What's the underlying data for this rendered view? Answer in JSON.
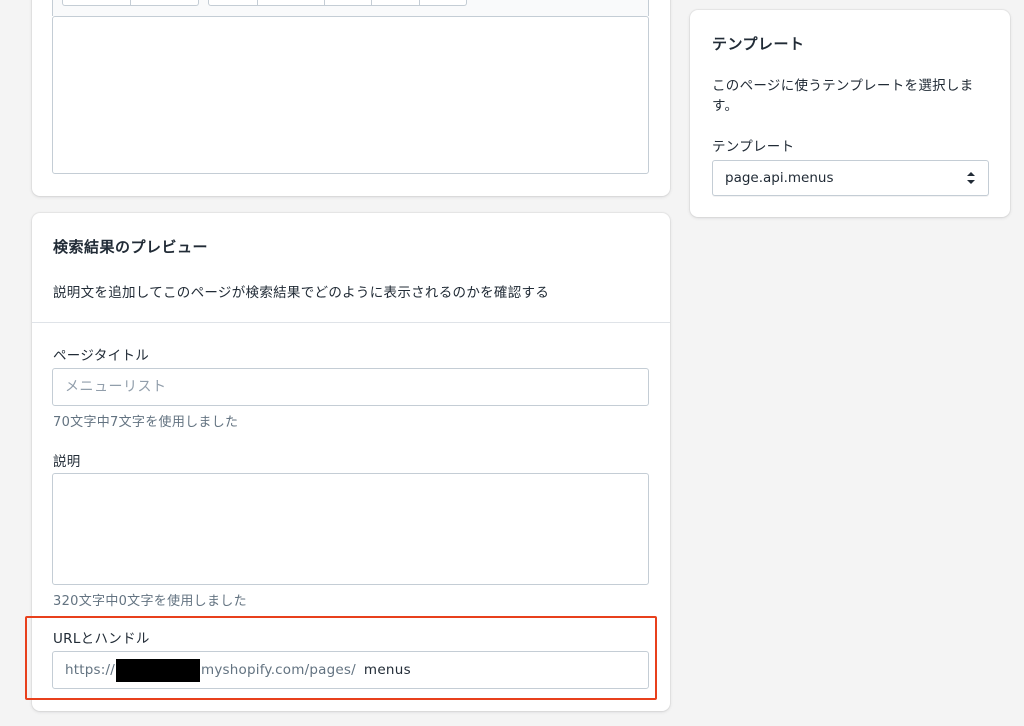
{
  "seo": {
    "title": "検索結果のプレビュー",
    "description": "説明文を追加してこのページが検索結果でどのように表示されるのかを確認する",
    "page_title_label": "ページタイトル",
    "page_title_placeholder": "メニューリスト",
    "page_title_counter": "70文字中7文字を使用しました",
    "description_label": "説明",
    "description_counter": "320文字中0文字を使用しました",
    "url_label": "URLとハンドル",
    "url_prefix_start": "https://",
    "url_prefix_end": "myshopify.com/pages/",
    "url_handle": "menus"
  },
  "template": {
    "title": "テンプレート",
    "description": "このページに使うテンプレートを選択します。",
    "field_label": "テンプレート",
    "selected_value": "page.api.menus"
  },
  "colors": {
    "highlight": "#e8401c",
    "background": "#f4f4f4"
  }
}
